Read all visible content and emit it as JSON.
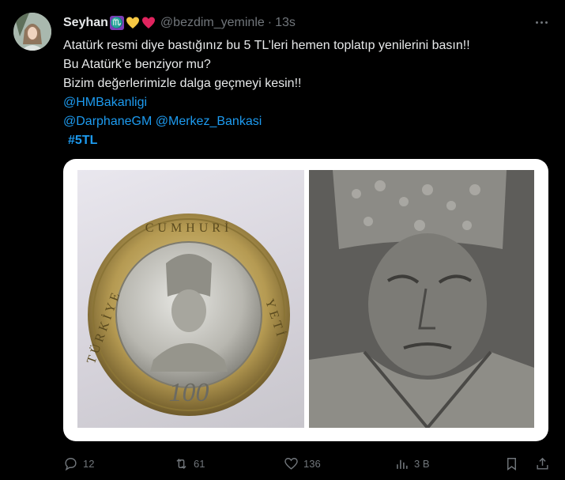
{
  "tweet": {
    "display_name": "Seyhan",
    "emojis": [
      "scorpio-sign",
      "yellow-heart",
      "red-heart"
    ],
    "scorpio_glyph": "♏",
    "handle": "@bezdim_yeminle",
    "separator": "·",
    "timestamp": "13s",
    "lines": [
      "Atatürk resmi diye bastığınız bu 5 TL’leri hemen toplatıp yenilerini basın!!",
      "Bu Atatürk’e benziyor mu?",
      "Bizim değerlerimizle dalga geçmeyi kesin!!"
    ],
    "mentions": {
      "line1": "@HMBakanligi",
      "line2a": "@DarphaneGM",
      "line2b": "@Merkez_Bankasi"
    },
    "hashtag": "#5TL",
    "coin_text": {
      "arc_top": "CUMHURİ",
      "arc_left": "TÜRKİYE",
      "arc_right": "YETİ",
      "bottom": "100"
    }
  },
  "actions": {
    "replies": "12",
    "reposts": "61",
    "likes": "136",
    "views": "3 B"
  },
  "colors": {
    "background": "#000000",
    "text": "#e7e9ea",
    "muted": "#71767b",
    "link": "#1d9bf0"
  }
}
